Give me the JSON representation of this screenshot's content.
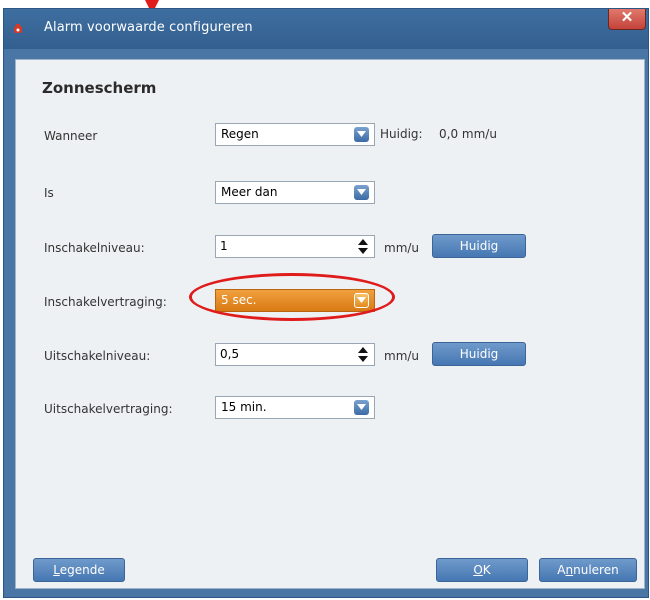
{
  "window": {
    "title": "Alarm voorwaarde configureren",
    "close_label": "✕"
  },
  "section_title": "Zonnescherm",
  "rows": {
    "wanneer": {
      "label": "Wanneer",
      "value": "Regen",
      "current_prefix": "Huidig:",
      "current_value": "0,0 mm/u"
    },
    "is": {
      "label": "Is",
      "value": "Meer dan"
    },
    "inschakelniveau": {
      "label": "Inschakelniveau:",
      "value": "1",
      "unit": "mm/u",
      "button": "Huidig"
    },
    "inschakelvertraging": {
      "label": "Inschakelvertraging:",
      "value": "5 sec."
    },
    "uitschakelniveau": {
      "label": "Uitschakelniveau:",
      "value": "0,5",
      "unit": "mm/u",
      "button": "Huidig"
    },
    "uitschakelvertraging": {
      "label": "Uitschakelvertraging:",
      "value": "15 min."
    }
  },
  "buttons": {
    "legend": {
      "mnemonic": "L",
      "rest": "egende"
    },
    "ok": {
      "mnemonic": "O",
      "rest": "K"
    },
    "cancel": {
      "pre": "A",
      "mnemonic": "n",
      "rest": "nuleren"
    }
  },
  "colors": {
    "highlight": "#e01b1b",
    "accent_orange": "#e28c1e",
    "frame_blue": "#4a76a6"
  }
}
